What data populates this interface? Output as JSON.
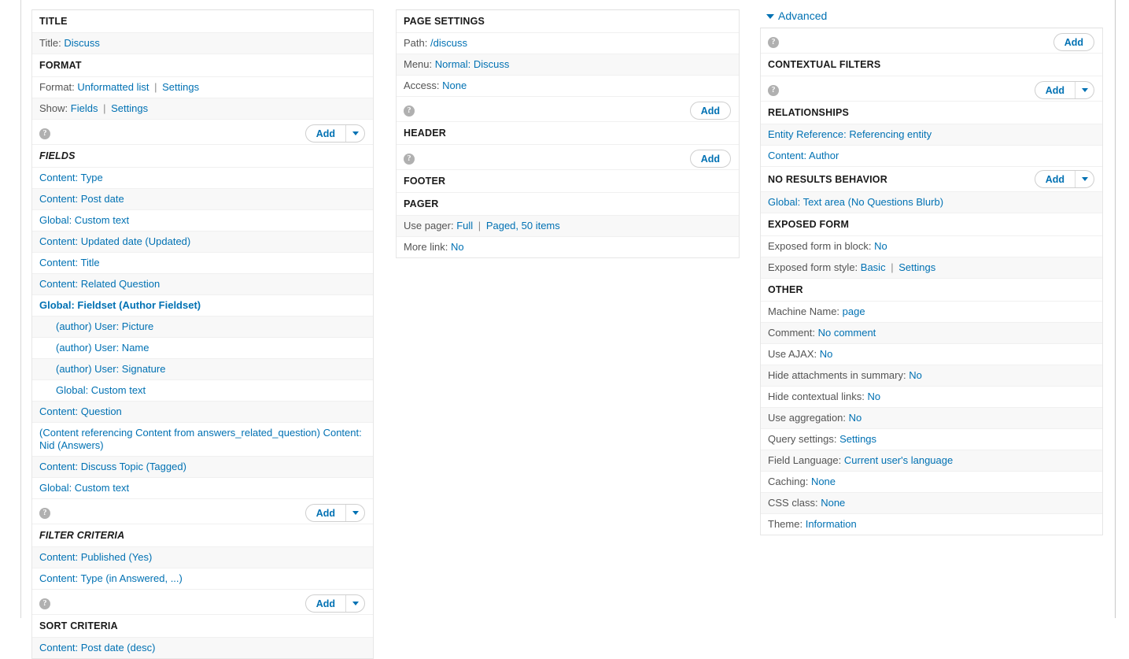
{
  "icons": {
    "help": "?",
    "help_name": "help-icon",
    "add_label": "Add",
    "caret": "▼"
  },
  "colors": {
    "link": "#0071b3",
    "label": "#545454",
    "heading": "#1a1a1a",
    "stripe": "#f8f8f8",
    "border": "#e6e6e6"
  },
  "left_column": {
    "title_section": {
      "heading": "TITLE",
      "label": "Title:",
      "value": "Discuss"
    },
    "format_section": {
      "heading": "FORMAT",
      "format_label": "Format:",
      "format_value": "Unformatted list",
      "format_settings": "Settings",
      "show_label": "Show:",
      "show_value": "Fields",
      "show_settings": "Settings"
    },
    "fields_section": {
      "heading": "FIELDS",
      "items": [
        {
          "label": "Content: Type",
          "nested": false,
          "bold": false
        },
        {
          "label": "Content: Post date",
          "nested": false,
          "bold": false
        },
        {
          "label": "Global: Custom text",
          "nested": false,
          "bold": false
        },
        {
          "label": "Content: Updated date (Updated)",
          "nested": false,
          "bold": false
        },
        {
          "label": "Content: Title",
          "nested": false,
          "bold": false
        },
        {
          "label": "Content: Related Question",
          "nested": false,
          "bold": false
        },
        {
          "label": "Global: Fieldset (Author Fieldset)",
          "nested": false,
          "bold": true
        },
        {
          "label": "(author) User: Picture",
          "nested": true,
          "bold": false
        },
        {
          "label": "(author) User: Name",
          "nested": true,
          "bold": false
        },
        {
          "label": "(author) User: Signature",
          "nested": true,
          "bold": false
        },
        {
          "label": "Global: Custom text",
          "nested": true,
          "bold": false
        },
        {
          "label": "Content: Question",
          "nested": false,
          "bold": false
        },
        {
          "label": "(Content referencing Content from answers_related_question) Content: Nid (Answers)",
          "nested": false,
          "bold": false
        },
        {
          "label": "Content: Discuss Topic (Tagged)",
          "nested": false,
          "bold": false
        },
        {
          "label": "Global: Custom text",
          "nested": false,
          "bold": false
        }
      ]
    },
    "filter_section": {
      "heading": "FILTER CRITERIA",
      "items": [
        {
          "label": "Content: Published (Yes)"
        },
        {
          "label": "Content: Type (in Answered, ...)"
        }
      ]
    },
    "sort_section": {
      "heading": "SORT CRITERIA",
      "items": [
        {
          "label": "Content: Post date (desc)"
        }
      ]
    }
  },
  "middle_column": {
    "page_settings": {
      "heading": "PAGE SETTINGS",
      "path_label": "Path:",
      "path_value": "/discuss",
      "menu_label": "Menu:",
      "menu_value": "Normal: Discuss",
      "access_label": "Access:",
      "access_value": "None"
    },
    "header_section": {
      "heading": "HEADER"
    },
    "footer_section": {
      "heading": "FOOTER"
    },
    "pager_section": {
      "heading": "PAGER",
      "use_pager_label": "Use pager:",
      "use_pager_value": "Full",
      "use_pager_detail": "Paged, 50 items",
      "more_link_label": "More link:",
      "more_link_value": "No"
    }
  },
  "right_column": {
    "advanced_toggle": "Advanced",
    "contextual_filters": {
      "heading": "CONTEXTUAL FILTERS"
    },
    "relationships": {
      "heading": "RELATIONSHIPS",
      "items": [
        {
          "label": "Entity Reference: Referencing entity"
        },
        {
          "label": "Content: Author"
        }
      ]
    },
    "no_results_behavior": {
      "heading": "NO RESULTS BEHAVIOR",
      "items": [
        {
          "label": "Global: Text area (No Questions Blurb)"
        }
      ]
    },
    "exposed_form": {
      "heading": "EXPOSED FORM",
      "in_block_label": "Exposed form in block:",
      "in_block_value": "No",
      "style_label": "Exposed form style:",
      "style_value": "Basic",
      "style_settings": "Settings"
    },
    "other": {
      "heading": "OTHER",
      "rows": [
        {
          "label": "Machine Name:",
          "value": "page"
        },
        {
          "label": "Comment:",
          "value": "No comment"
        },
        {
          "label": "Use AJAX:",
          "value": "No"
        },
        {
          "label": "Hide attachments in summary:",
          "value": "No"
        },
        {
          "label": "Hide contextual links:",
          "value": "No"
        },
        {
          "label": "Use aggregation:",
          "value": "No"
        },
        {
          "label": "Query settings:",
          "value": "Settings"
        },
        {
          "label": "Field Language:",
          "value": "Current user's language"
        },
        {
          "label": "Caching:",
          "value": "None"
        },
        {
          "label": "CSS class:",
          "value": "None"
        },
        {
          "label": "Theme:",
          "value": "Information"
        }
      ]
    }
  }
}
